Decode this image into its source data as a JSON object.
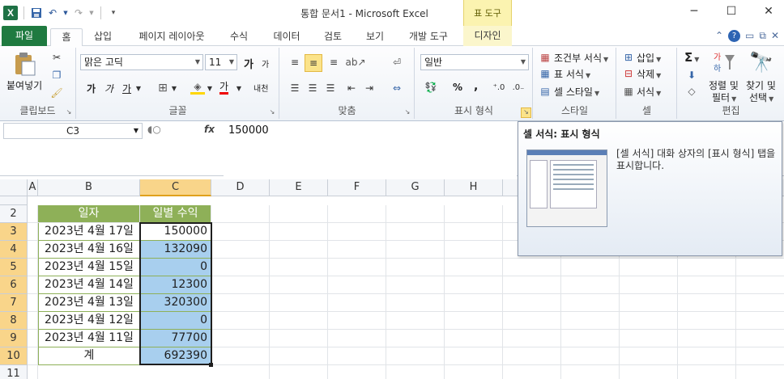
{
  "window": {
    "title": "통합 문서1 - Microsoft Excel",
    "app_icon": "X",
    "controls": [
      "─",
      "☐",
      "✕"
    ]
  },
  "context_tool": {
    "label": "표 도구"
  },
  "tabs": [
    {
      "label": "파일"
    },
    {
      "label": "홈"
    },
    {
      "label": "삽입"
    },
    {
      "label": "페이지 레이아웃"
    },
    {
      "label": "수식"
    },
    {
      "label": "데이터"
    },
    {
      "label": "검토"
    },
    {
      "label": "보기"
    },
    {
      "label": "개발 도구"
    },
    {
      "label": "디자인"
    }
  ],
  "ribbon": {
    "clipboard": {
      "paste": "붙여넣기",
      "label": "클립보드"
    },
    "font": {
      "name": "맑은 고딕",
      "size": "11",
      "label": "글꼴",
      "grow": "가",
      "shrink": "가",
      "bold": "가",
      "italic": "가",
      "underline": "가",
      "color_a": "가",
      "phonetic": "내천"
    },
    "align": {
      "label": "맞춤"
    },
    "number": {
      "format": "일반",
      "label": "표시 형식",
      "percent": "%",
      "comma": ","
    },
    "styles": {
      "conditional": "조건부 서식",
      "table": "표 서식",
      "cell": "셀 스타일",
      "label": "스타일"
    },
    "cells": {
      "insert": "삽입",
      "delete": "삭제",
      "format": "서식",
      "label": "셀"
    },
    "editing": {
      "sort": "정렬 및",
      "sort2": "필터",
      "find": "찾기 및",
      "find2": "선택",
      "label": "편집",
      "sigma": "Σ"
    }
  },
  "formula_bar": {
    "name_box": "C3",
    "fx": "fx",
    "value": "150000"
  },
  "columns": [
    "A",
    "B",
    "C",
    "D",
    "E",
    "F",
    "G",
    "H"
  ],
  "rows": [
    "2",
    "3",
    "4",
    "5",
    "6",
    "7",
    "8",
    "9",
    "10",
    "11"
  ],
  "table": {
    "headers": [
      "일자",
      "일별 수익"
    ],
    "rows": [
      [
        "2023년 4월 17일",
        "150000"
      ],
      [
        "2023년 4월 16일",
        "132090"
      ],
      [
        "2023년 4월 15일",
        "0"
      ],
      [
        "2023년 4월 14일",
        "12300"
      ],
      [
        "2023년 4월 13일",
        "320300"
      ],
      [
        "2023년 4월 12일",
        "0"
      ],
      [
        "2023년 4월 11일",
        "77700"
      ],
      [
        "계",
        "692390"
      ]
    ]
  },
  "tooltip": {
    "title": "셀 서식: 표시 형식",
    "body": "[셀 서식] 대화 상자의 [표시 형식] 탭을 표시합니다."
  },
  "colors": {
    "accent": "#1f7a40",
    "table_header": "#8eb058",
    "selection": "#a8cfee",
    "highlight": "#f9d58a"
  }
}
